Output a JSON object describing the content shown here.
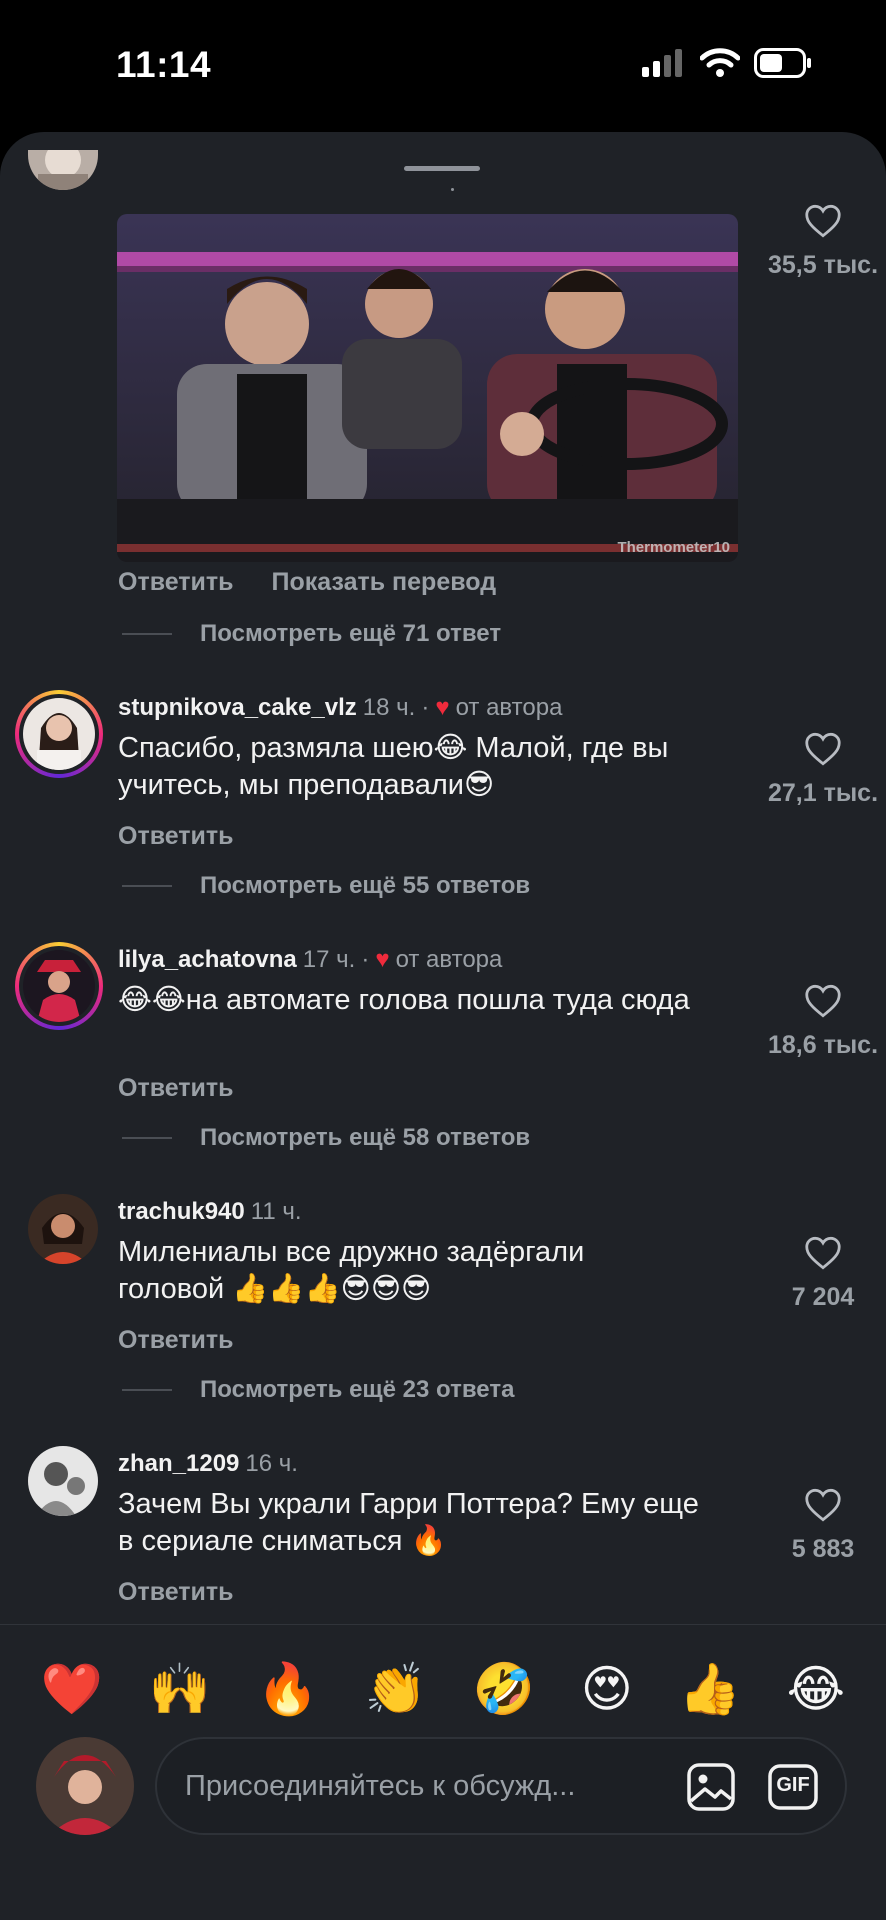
{
  "status_bar": {
    "time": "11:14"
  },
  "top_comment": {
    "gif_watermark": "Thermometer10",
    "reply_label": "Ответить",
    "translate_label": "Показать перевод",
    "likes": "35,5 тыс.",
    "view_more": "Посмотреть ещё 71 ответ"
  },
  "comments": [
    {
      "username": "stupnikova_cake_vlz",
      "time": "18 ч.",
      "author_badge": "от автора",
      "text": "Спасибо,  размяла шею😂 Малой, где вы учитесь, мы преподавали😎",
      "reply_label": "Ответить",
      "likes": "27,1 тыс.",
      "view_more": "Посмотреть ещё 55 ответов"
    },
    {
      "username": "lilya_achatovna",
      "time": "17 ч.",
      "author_badge": "от автора",
      "text": "😂😂на автомате голова пошла туда сюда",
      "reply_label": "Ответить",
      "likes": "18,6 тыс.",
      "view_more": "Посмотреть ещё 58 ответов"
    },
    {
      "username": "trachuk940",
      "time": "11 ч.",
      "text": "Милениалы все дружно задёргали головой 👍👍👍😎😎😎",
      "reply_label": "Ответить",
      "likes": "7 204",
      "view_more": "Посмотреть ещё 23 ответа"
    },
    {
      "username": "zhan_1209",
      "time": "16 ч.",
      "text": "Зачем Вы украли Гарри Поттера? Ему еще в сериале сниматься 🔥",
      "reply_label": "Ответить",
      "likes": "5 883"
    }
  ],
  "quick_reactions": [
    "❤️",
    "🙌",
    "🔥",
    "👏",
    "🤣",
    "😍",
    "👍",
    "😂"
  ],
  "composer": {
    "placeholder": "Присоединяйтесь к обсужд...",
    "gif_label": "GIF"
  },
  "colors": {
    "background": "#1f2227",
    "accent_heart": "#ef2b3c",
    "muted_text": "#9aa0a6"
  }
}
